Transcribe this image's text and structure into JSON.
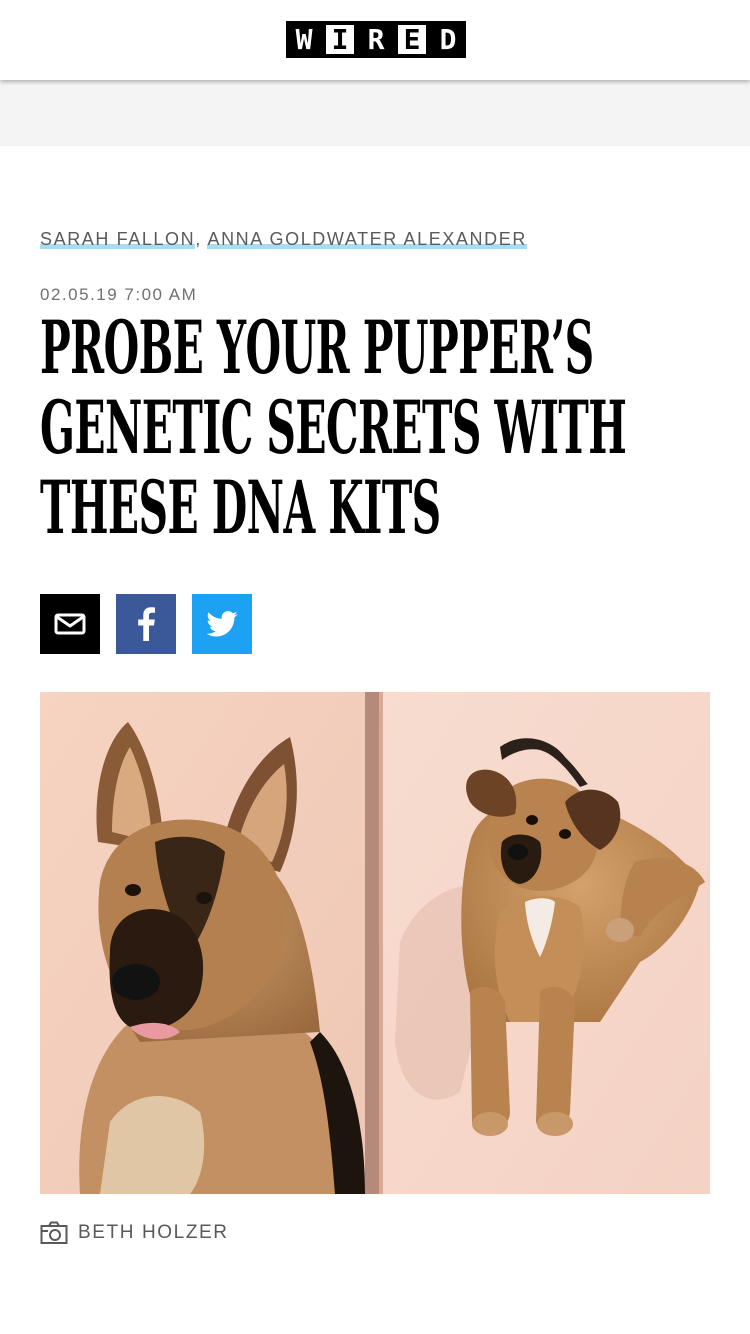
{
  "header": {
    "logo_letters": [
      "W",
      "I",
      "R",
      "E",
      "D"
    ]
  },
  "article": {
    "authors": [
      "SARAH FALLON",
      "ANNA GOLDWATER ALEXANDER"
    ],
    "author_separator": ",",
    "date": "02.05.19 7:00 AM",
    "title": "PROBE YOUR PUPPER’S GENETIC SECRETS WITH THESE DNA KITS",
    "share": {
      "email_icon": "email-icon",
      "facebook_icon": "facebook-icon",
      "twitter_icon": "twitter-icon"
    },
    "photo_credit": "BETH HOLZER"
  },
  "colors": {
    "facebook": "#3b5998",
    "twitter": "#1da1f2",
    "author_underline": "#a8dcf3",
    "photo_background": "#f3cdbb"
  }
}
